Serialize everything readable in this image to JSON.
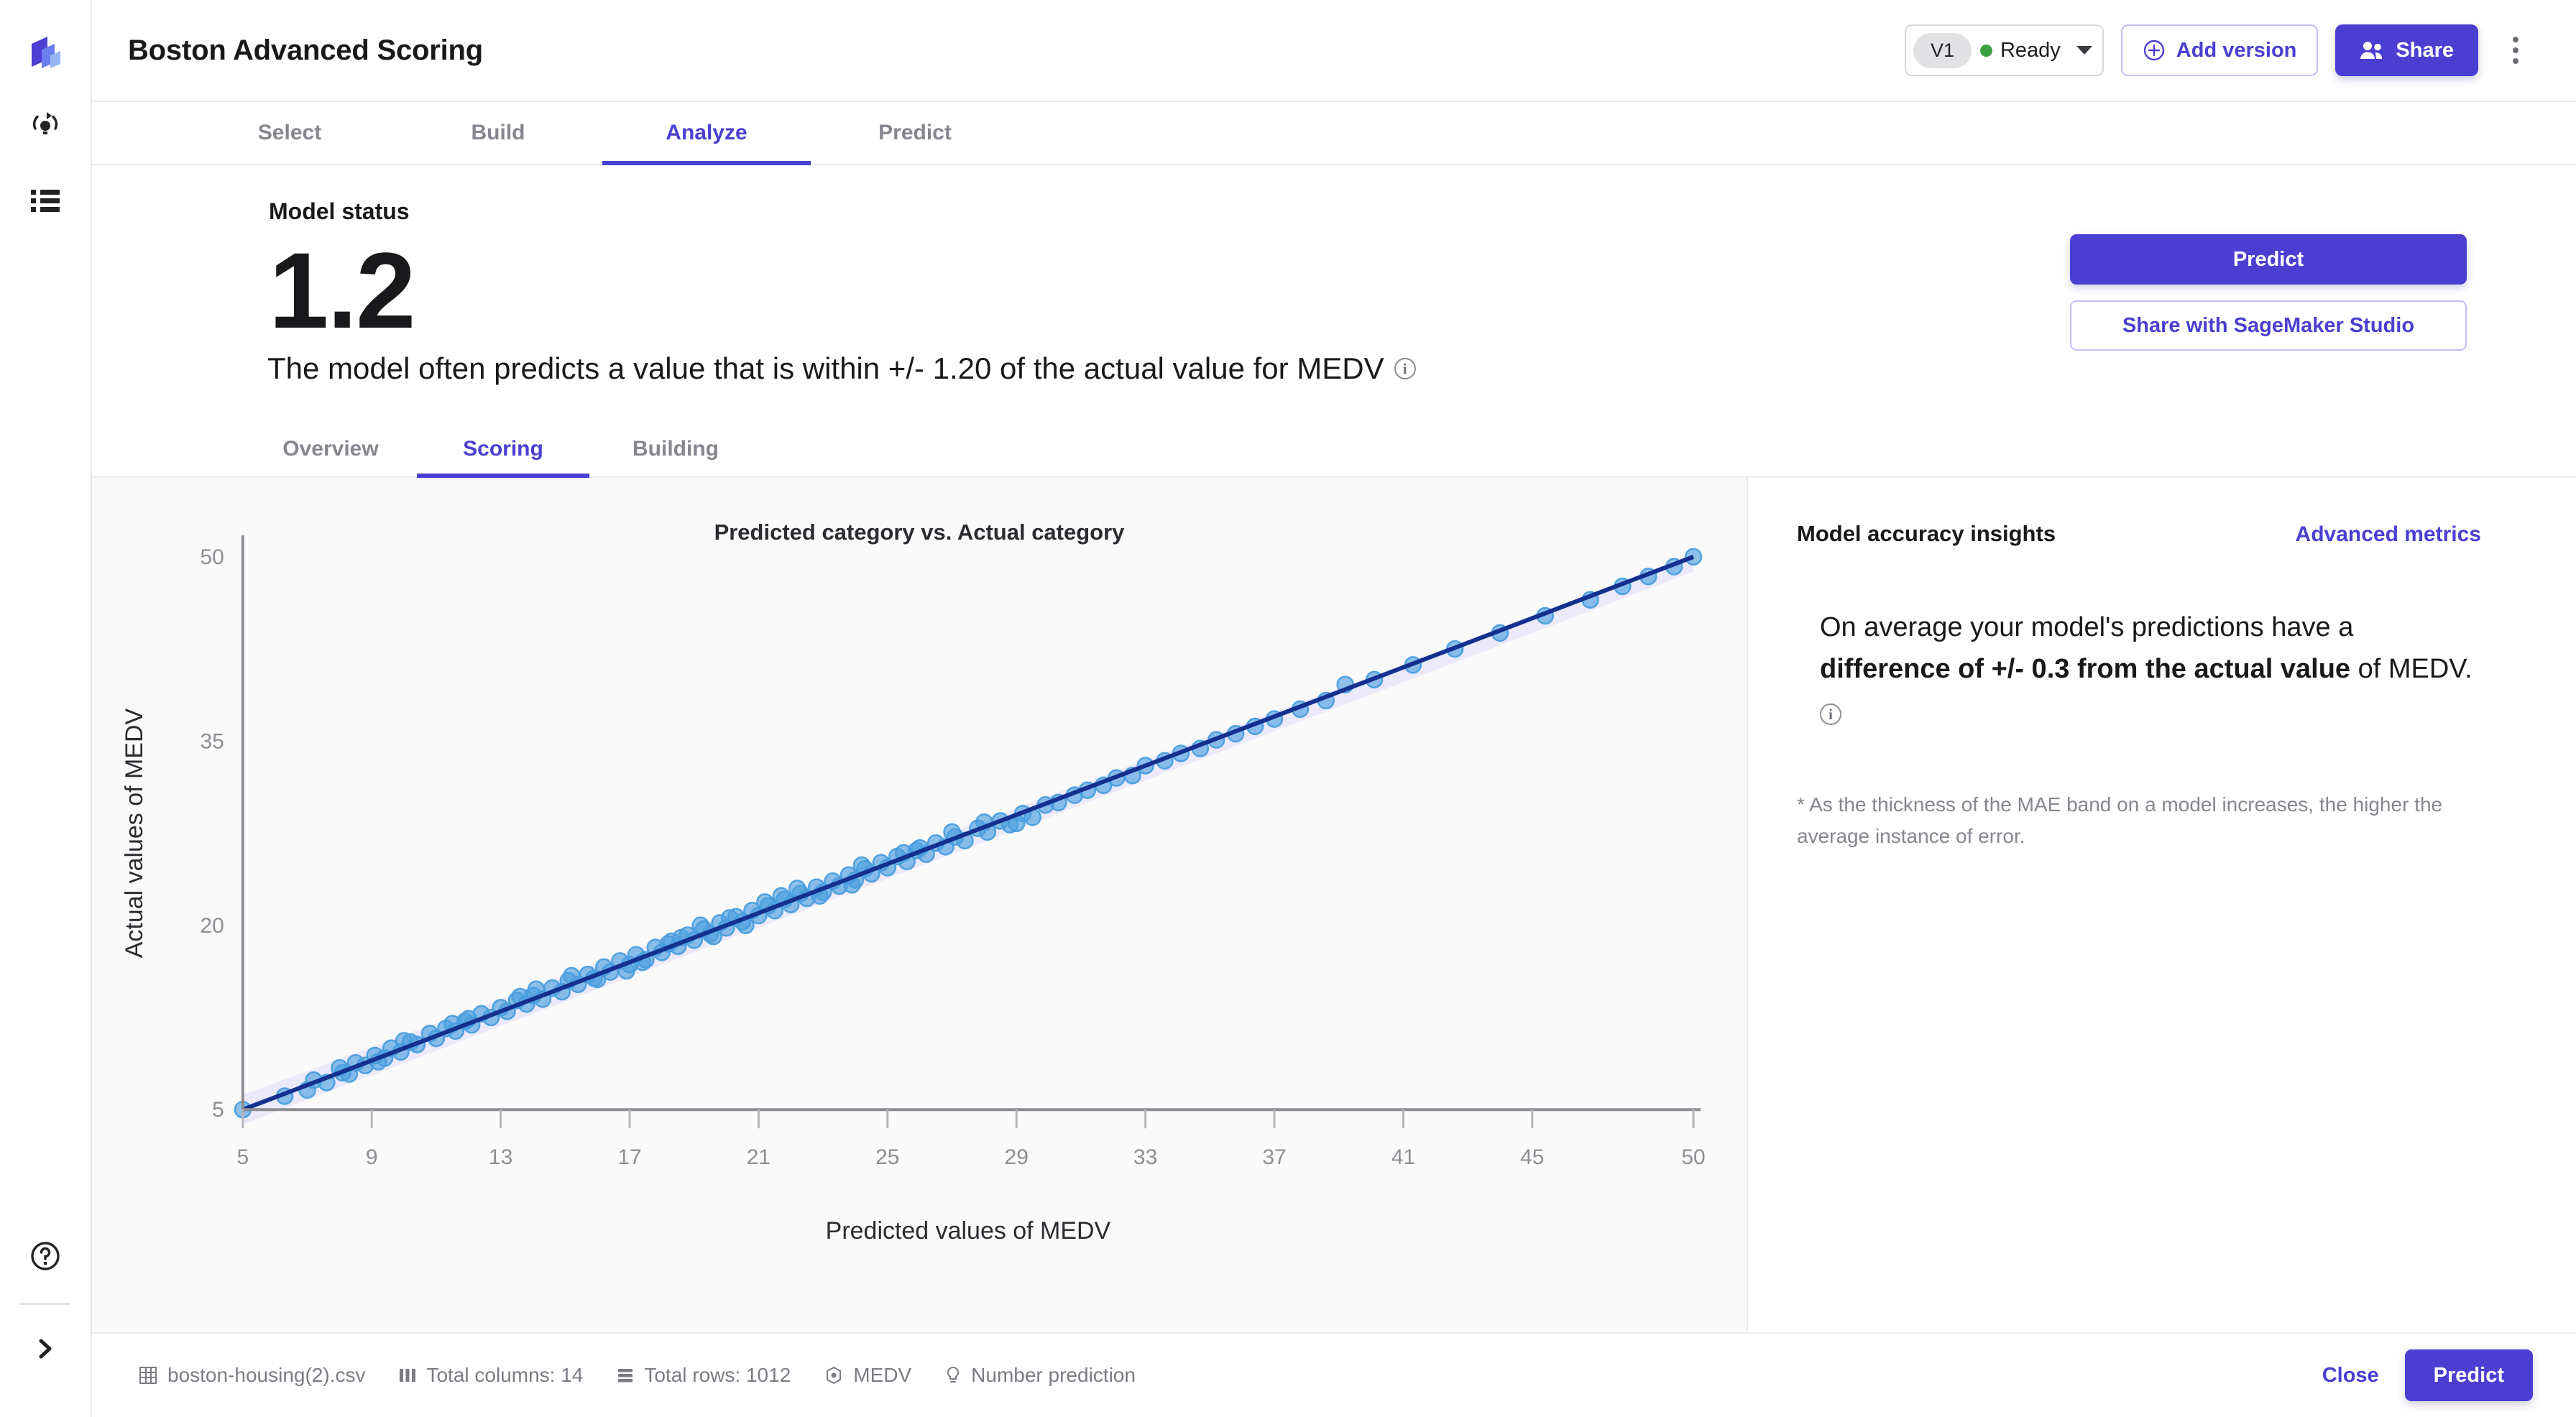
{
  "app": {
    "title": "Boston Advanced Scoring",
    "logo_icon": "layers-logo-icon"
  },
  "rail": {
    "items": [
      {
        "icon": "insight-bulb-refresh-icon",
        "name": "insights"
      },
      {
        "icon": "list-icon",
        "name": "list"
      }
    ],
    "bottom": [
      {
        "icon": "help-circle-icon",
        "name": "help"
      },
      {
        "icon": "chevron-right-icon",
        "name": "expand-sidebar"
      }
    ]
  },
  "header": {
    "version": {
      "chip": "V1",
      "status": "Ready",
      "status_color": "#3c9e43",
      "caret_icon": "chevron-down-icon"
    },
    "add_version": {
      "label": "Add version",
      "icon": "plus-circle-icon"
    },
    "share": {
      "label": "Share",
      "icon": "people-icon"
    },
    "more_icon": "kebab-menu-icon"
  },
  "tabs": [
    {
      "label": "Select",
      "active": false
    },
    {
      "label": "Build",
      "active": false
    },
    {
      "label": "Analyze",
      "active": true
    },
    {
      "label": "Predict",
      "active": false
    }
  ],
  "status": {
    "label": "Model status",
    "score": "1.2",
    "sentence": "The model often predicts a value that is within +/- 1.20 of the actual value for MEDV",
    "info_icon": "info-icon",
    "predict_label": "Predict",
    "share_sagemaker_label": "Share with SageMaker Studio"
  },
  "subtabs": [
    {
      "label": "Overview",
      "active": false
    },
    {
      "label": "Scoring",
      "active": true
    },
    {
      "label": "Building",
      "active": false
    }
  ],
  "insights": {
    "title": "Model accuracy insights",
    "link": "Advanced metrics",
    "body_pre": "On average your model's predictions have a ",
    "body_bold1": "difference of +/- 0.3 from the actual value",
    "body_mid": " of MEDV.",
    "info_icon": "info-icon",
    "note": "* As the thickness of the MAE band on a model increases, the higher the average instance of error."
  },
  "footer": {
    "meta": [
      {
        "icon": "table-icon",
        "label": "boston-housing(2).csv"
      },
      {
        "icon": "columns-icon",
        "label": "Total columns: 14"
      },
      {
        "icon": "rows-icon",
        "label": "Total rows: 1012"
      },
      {
        "icon": "target-icon",
        "label": "MEDV"
      },
      {
        "icon": "bulb-icon",
        "label": "Number prediction"
      }
    ],
    "close_label": "Close",
    "predict_label": "Predict"
  },
  "colors": {
    "accent": "#4a3fd1",
    "point": "#4a9ede",
    "line": "#14308f",
    "band": "#ebe9fa",
    "ready": "#3c9e43"
  },
  "chart_data": {
    "type": "scatter",
    "title": "Predicted category vs. Actual category",
    "xlabel": "Predicted values of MEDV",
    "ylabel": "Actual values of MEDV",
    "xlim": [
      5,
      50
    ],
    "ylim": [
      5,
      50
    ],
    "xticks": [
      5,
      9,
      13,
      17,
      21,
      25,
      29,
      33,
      37,
      41,
      45,
      50
    ],
    "yticks": [
      5,
      20,
      35,
      50
    ],
    "grid": false,
    "legend": null,
    "reference_line": {
      "type": "identity",
      "from": [
        5,
        5
      ],
      "to": [
        50,
        50
      ],
      "color": "#14308f",
      "width": 4
    },
    "mae_band": {
      "half_width": 1.2,
      "color": "#ebe9fa",
      "label": "MAE band"
    },
    "points": [
      [
        5.0,
        5.0
      ],
      [
        6.3,
        6.1
      ],
      [
        7.0,
        6.6
      ],
      [
        7.2,
        7.4
      ],
      [
        7.6,
        7.2
      ],
      [
        8.1,
        8.0
      ],
      [
        8.3,
        7.9
      ],
      [
        8.5,
        8.8
      ],
      [
        8.8,
        8.6
      ],
      [
        9.1,
        9.4
      ],
      [
        9.4,
        9.2
      ],
      [
        9.6,
        10.0
      ],
      [
        9.9,
        9.7
      ],
      [
        10.2,
        10.5
      ],
      [
        10.4,
        10.3
      ],
      [
        10.8,
        11.2
      ],
      [
        11.0,
        10.8
      ],
      [
        11.3,
        11.6
      ],
      [
        11.6,
        11.4
      ],
      [
        11.9,
        12.2
      ],
      [
        12.1,
        11.9
      ],
      [
        12.4,
        12.8
      ],
      [
        12.7,
        12.5
      ],
      [
        13.0,
        13.3
      ],
      [
        13.2,
        13.0
      ],
      [
        13.5,
        13.9
      ],
      [
        13.8,
        13.6
      ],
      [
        14.0,
        14.3
      ],
      [
        14.3,
        14.0
      ],
      [
        14.6,
        14.9
      ],
      [
        14.9,
        14.6
      ],
      [
        15.1,
        15.5
      ],
      [
        15.4,
        15.2
      ],
      [
        15.7,
        16.0
      ],
      [
        15.9,
        15.7
      ],
      [
        16.2,
        16.6
      ],
      [
        16.4,
        16.2
      ],
      [
        16.7,
        17.1
      ],
      [
        17.0,
        16.8
      ],
      [
        17.2,
        17.6
      ],
      [
        17.5,
        17.2
      ],
      [
        17.8,
        18.2
      ],
      [
        18.0,
        17.8
      ],
      [
        18.3,
        18.7
      ],
      [
        18.5,
        18.3
      ],
      [
        18.8,
        19.2
      ],
      [
        19.0,
        18.8
      ],
      [
        19.3,
        19.7
      ],
      [
        19.5,
        19.3
      ],
      [
        19.8,
        20.2
      ],
      [
        20.0,
        19.8
      ],
      [
        20.3,
        20.7
      ],
      [
        20.5,
        20.3
      ],
      [
        20.8,
        21.2
      ],
      [
        21.0,
        20.8
      ],
      [
        21.3,
        21.6
      ],
      [
        21.5,
        21.2
      ],
      [
        21.8,
        22.1
      ],
      [
        22.0,
        21.7
      ],
      [
        22.3,
        22.6
      ],
      [
        22.5,
        22.2
      ],
      [
        22.8,
        23.1
      ],
      [
        23.0,
        22.7
      ],
      [
        23.3,
        23.6
      ],
      [
        23.5,
        23.2
      ],
      [
        23.8,
        24.1
      ],
      [
        24.0,
        23.7
      ],
      [
        24.3,
        24.6
      ],
      [
        24.5,
        24.2
      ],
      [
        24.8,
        25.1
      ],
      [
        25.0,
        24.7
      ],
      [
        25.3,
        25.6
      ],
      [
        25.6,
        25.2
      ],
      [
        25.9,
        26.1
      ],
      [
        26.2,
        25.8
      ],
      [
        26.5,
        26.7
      ],
      [
        26.8,
        26.4
      ],
      [
        27.1,
        27.2
      ],
      [
        27.4,
        26.9
      ],
      [
        27.8,
        27.9
      ],
      [
        28.1,
        27.6
      ],
      [
        28.5,
        28.5
      ],
      [
        28.8,
        28.2
      ],
      [
        29.2,
        29.1
      ],
      [
        29.5,
        28.8
      ],
      [
        29.9,
        29.8
      ],
      [
        30.3,
        30.0
      ],
      [
        30.8,
        30.6
      ],
      [
        31.2,
        31.0
      ],
      [
        31.7,
        31.4
      ],
      [
        32.1,
        32.0
      ],
      [
        32.6,
        32.2
      ],
      [
        33.0,
        33.0
      ],
      [
        33.6,
        33.4
      ],
      [
        34.1,
        34.0
      ],
      [
        34.7,
        34.4
      ],
      [
        35.2,
        35.1
      ],
      [
        35.8,
        35.6
      ],
      [
        36.4,
        36.2
      ],
      [
        37.0,
        36.8
      ],
      [
        37.8,
        37.6
      ],
      [
        38.6,
        38.3
      ],
      [
        39.2,
        39.6
      ],
      [
        40.1,
        40.0
      ],
      [
        41.3,
        41.2
      ],
      [
        42.6,
        42.5
      ],
      [
        44.0,
        43.8
      ],
      [
        45.4,
        45.2
      ],
      [
        46.8,
        46.5
      ],
      [
        47.8,
        47.6
      ],
      [
        48.6,
        48.4
      ],
      [
        49.4,
        49.2
      ],
      [
        50.0,
        50.0
      ],
      [
        12.0,
        12.4
      ],
      [
        16.0,
        15.6
      ],
      [
        20.6,
        20.0
      ],
      [
        21.2,
        21.9
      ],
      [
        22.2,
        23.0
      ],
      [
        23.9,
        23.3
      ],
      [
        25.5,
        25.9
      ],
      [
        26.0,
        26.3
      ],
      [
        27.0,
        27.6
      ],
      [
        28.0,
        28.4
      ],
      [
        19.2,
        20.0
      ],
      [
        18.2,
        18.5
      ],
      [
        17.4,
        17.0
      ],
      [
        14.1,
        14.8
      ],
      [
        29.0,
        28.3
      ],
      [
        24.2,
        24.9
      ],
      [
        22.9,
        22.4
      ],
      [
        21.7,
        22.4
      ],
      [
        20.1,
        20.6
      ],
      [
        19.6,
        19.1
      ],
      [
        18.6,
        19.0
      ],
      [
        16.9,
        16.3
      ],
      [
        15.2,
        15.9
      ],
      [
        13.6,
        14.2
      ],
      [
        11.5,
        12.0
      ],
      [
        10.0,
        10.6
      ],
      [
        9.2,
        8.9
      ],
      [
        8.0,
        8.4
      ]
    ]
  }
}
